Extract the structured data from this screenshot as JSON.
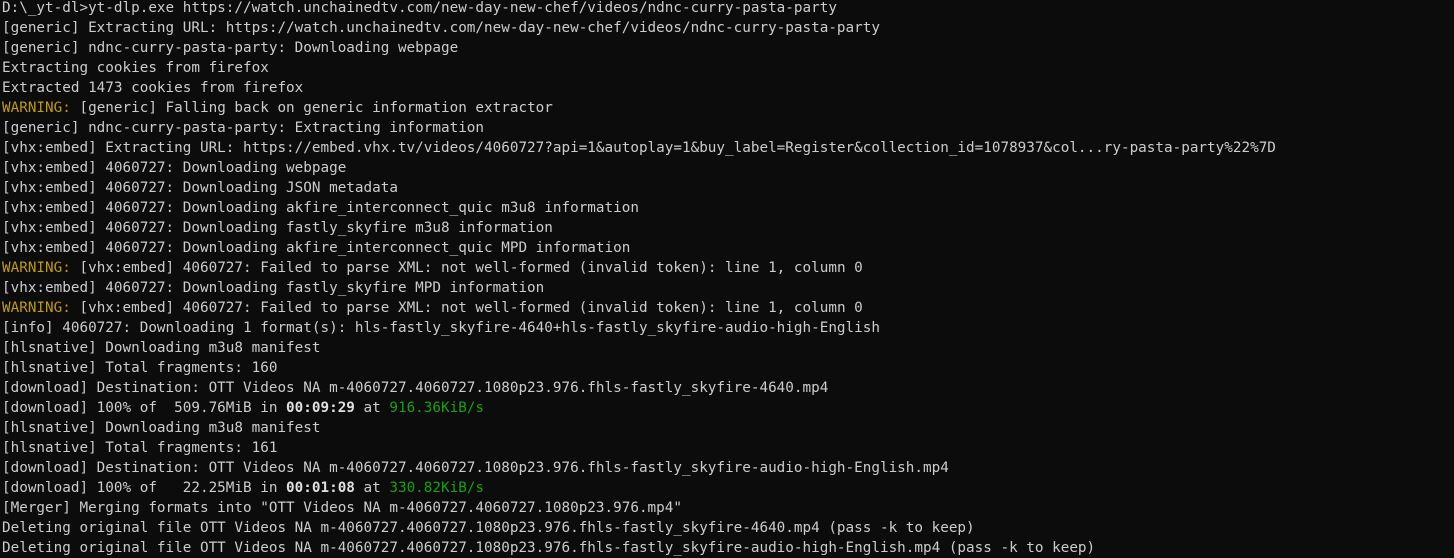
{
  "terminal": {
    "colors": {
      "background": "#0c0c0c",
      "text": "#cccccc",
      "warning": "#c19c00",
      "speed": "#13a10e"
    },
    "lines": [
      {
        "text": "D:\\_yt-dl>yt-dlp.exe https://watch.unchainedtv.com/new-day-new-chef/videos/ndnc-curry-pasta-party"
      },
      {
        "text": "[generic] Extracting URL: https://watch.unchainedtv.com/new-day-new-chef/videos/ndnc-curry-pasta-party"
      },
      {
        "text": "[generic] ndnc-curry-pasta-party: Downloading webpage"
      },
      {
        "text": "Extracting cookies from firefox"
      },
      {
        "text": "Extracted 1473 cookies from firefox"
      },
      {
        "prefix": "WARNING:",
        "text": " [generic] Falling back on generic information extractor"
      },
      {
        "text": "[generic] ndnc-curry-pasta-party: Extracting information"
      },
      {
        "text": "[vhx:embed] Extracting URL: https://embed.vhx.tv/videos/4060727?api=1&autoplay=1&buy_label=Register&collection_id=1078937&col...ry-pasta-party%22%7D"
      },
      {
        "text": "[vhx:embed] 4060727: Downloading webpage"
      },
      {
        "text": "[vhx:embed] 4060727: Downloading JSON metadata"
      },
      {
        "text": "[vhx:embed] 4060727: Downloading akfire_interconnect_quic m3u8 information"
      },
      {
        "text": "[vhx:embed] 4060727: Downloading fastly_skyfire m3u8 information"
      },
      {
        "text": "[vhx:embed] 4060727: Downloading akfire_interconnect_quic MPD information"
      },
      {
        "prefix": "WARNING:",
        "text": " [vhx:embed] 4060727: Failed to parse XML: not well-formed (invalid token): line 1, column 0"
      },
      {
        "text": "[vhx:embed] 4060727: Downloading fastly_skyfire MPD information"
      },
      {
        "prefix": "WARNING:",
        "text": " [vhx:embed] 4060727: Failed to parse XML: not well-formed (invalid token): line 1, column 0"
      },
      {
        "text": "[info] 4060727: Downloading 1 format(s): hls-fastly_skyfire-4640+hls-fastly_skyfire-audio-high-English"
      },
      {
        "text": "[hlsnative] Downloading m3u8 manifest"
      },
      {
        "text": "[hlsnative] Total fragments: 160"
      },
      {
        "text": "[download] Destination: OTT Videos NA m-4060727.4060727.1080p23.976.fhls-fastly_skyfire-4640.mp4"
      },
      {
        "progress": {
          "head": "[download] 100% of  509.76MiB in ",
          "time": "00:09:29",
          "mid": " at ",
          "speed": "916.36KiB/s"
        }
      },
      {
        "text": "[hlsnative] Downloading m3u8 manifest"
      },
      {
        "text": "[hlsnative] Total fragments: 161"
      },
      {
        "text": "[download] Destination: OTT Videos NA m-4060727.4060727.1080p23.976.fhls-fastly_skyfire-audio-high-English.mp4"
      },
      {
        "progress": {
          "head": "[download] 100% of   22.25MiB in ",
          "time": "00:01:08",
          "mid": " at ",
          "speed": "330.82KiB/s"
        }
      },
      {
        "text": "[Merger] Merging formats into \"OTT Videos NA m-4060727.4060727.1080p23.976.mp4\""
      },
      {
        "text": "Deleting original file OTT Videos NA m-4060727.4060727.1080p23.976.fhls-fastly_skyfire-4640.mp4 (pass -k to keep)"
      },
      {
        "text": "Deleting original file OTT Videos NA m-4060727.4060727.1080p23.976.fhls-fastly_skyfire-audio-high-English.mp4 (pass -k to keep)"
      }
    ]
  }
}
